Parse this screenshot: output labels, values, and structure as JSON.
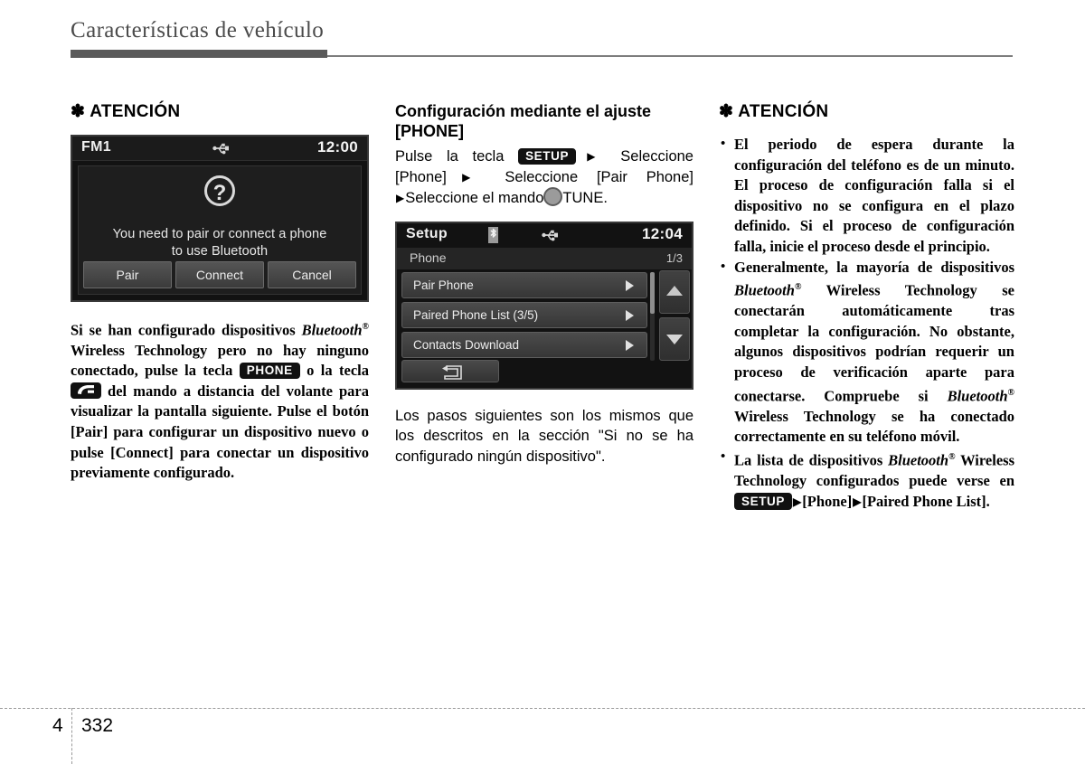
{
  "header": {
    "title": "Características de vehículo"
  },
  "footer": {
    "chapter": "4",
    "page": "332"
  },
  "column1": {
    "attention_heading": "ATENCIÓN",
    "star_glyph": "✽",
    "screen": {
      "name": "fm1-bluetooth-pair-dialog",
      "statusbar": {
        "source_label": "FM1",
        "usb_icon": "usb-icon",
        "clock": "12:00"
      },
      "dialog_icon": "question-mark-icon",
      "dialog_icon_glyph": "?",
      "message_line1": "You need to pair or connect a phone",
      "message_line2": "to use Bluetooth",
      "buttons": [
        "Pair",
        "Connect",
        "Cancel"
      ]
    },
    "body": {
      "p1_a": "Si se han configurado dispositivos ",
      "p1_bluetooth": "Bluetooth",
      "p1_sup": "®",
      "p1_b": " Wireless Technology pero no hay ninguno conectado, pulse la tecla ",
      "key_phone": "PHONE",
      "p1_c": " o la tecla ",
      "key_phone_icon": "phone-handset-icon",
      "p1_d": " del mando a distancia del volante para visualizar la pantalla siguiente. Pulse el botón [Pair] para configurar un dispositivo nuevo o pulse [Connect] para conectar un dispositivo previamente configurado."
    }
  },
  "column2": {
    "heading_line1": "Configuración mediante el ajuste",
    "heading_line2": "[PHONE]",
    "steps": {
      "a": "Pulse la tecla ",
      "key_setup": "SETUP",
      "arrow": "▶",
      "b": " Seleccione [Phone]",
      "c": " Seleccione [Pair Phone] ",
      "d": "Seleccione el mando",
      "tune_knob": "tune-knob-icon",
      "e": "TUNE."
    },
    "screen": {
      "name": "setup-phone-menu",
      "statusbar": {
        "title": "Setup",
        "bluetooth_icon": "bluetooth-icon",
        "usb_icon": "usb-icon",
        "clock": "12:04"
      },
      "subbar": {
        "label": "Phone",
        "page_indicator": "1/3"
      },
      "rows": [
        {
          "label": "Pair Phone",
          "arrow": "chevron-right-icon"
        },
        {
          "label": "Paired Phone List (3/5)",
          "arrow": "chevron-right-icon"
        },
        {
          "label": "Contacts Download",
          "arrow": "chevron-right-icon"
        }
      ],
      "scroll_up": "scroll-up-arrow",
      "scroll_down": "scroll-down-arrow",
      "back_button": "back-arrow-icon"
    },
    "note": "Los pasos siguientes son los mismos que los descritos en la sección \"Si no se ha configurado ningún dispositivo\"."
  },
  "column3": {
    "attention_heading": "ATENCIÓN",
    "star_glyph": "✽",
    "bullets": [
      {
        "text": "El periodo de espera durante la configuración del teléfono es de un minuto. El proceso de configuración falla si el dispositivo no se configura en el plazo definido. Si el proceso de configuración falla, inicie el proceso desde el principio."
      },
      {
        "a": "Generalmente, la mayoría de dispositivos ",
        "bt1": "Bluetooth",
        "sup1": "®",
        "b": " Wireless Technology se conectarán automáticamente tras completar la configuración. No obstante, algunos dispositivos podrían requerir un proceso de verificación aparte para conectarse. Compruebe si ",
        "bt2": "Bluetooth",
        "sup2": "®",
        "c": " Wireless Technology se ha conectado correctamente en su teléfono móvil."
      },
      {
        "a": "La lista de dispositivos ",
        "bt1": "Bluetooth",
        "sup1": "®",
        "b": " Wireless Technology configurados puede verse en ",
        "key_setup": "SETUP",
        "arrow": "▶",
        "c": "[Phone]",
        "d": "[Paired Phone List]."
      }
    ]
  },
  "colors": {
    "header_rule": "#5a5a5a",
    "header_text": "#4b4b4b",
    "screen_bg": "#121212",
    "key_badge_bg": "#111111"
  }
}
